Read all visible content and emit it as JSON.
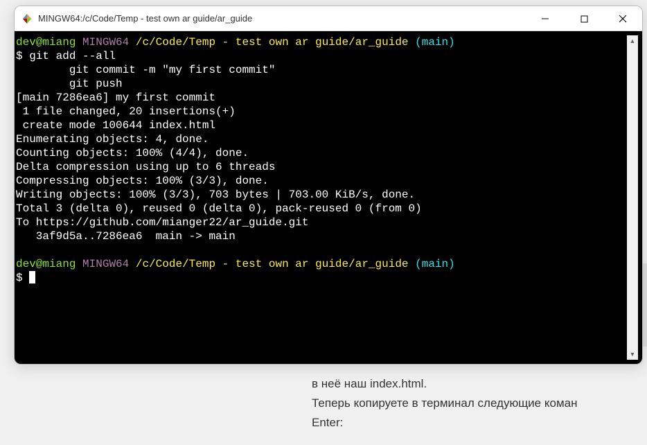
{
  "window": {
    "title": "MINGW64:/c/Code/Temp - test own ar guide/ar_guide"
  },
  "prompt": {
    "user_host": "dev@miang",
    "env": "MINGW64",
    "path": "/c/Code/Temp - test own ar guide/ar_guide",
    "branch_open": "(",
    "branch": "main",
    "branch_close": ")",
    "dollar": "$ "
  },
  "commands": {
    "cmd1": "git add --all",
    "cmd2": "        git commit -m \"my first commit\"",
    "cmd3": "        git push"
  },
  "output": {
    "l1": "[main 7286ea6] my first commit",
    "l2": " 1 file changed, 20 insertions(+)",
    "l3": " create mode 100644 index.html",
    "l4": "Enumerating objects: 4, done.",
    "l5": "Counting objects: 100% (4/4), done.",
    "l6": "Delta compression using up to 6 threads",
    "l7": "Compressing objects: 100% (3/3), done.",
    "l8": "Writing objects: 100% (3/3), 703 bytes | 703.00 KiB/s, done.",
    "l9": "Total 3 (delta 0), reused 0 (delta 0), pack-reused 0 (from 0)",
    "l10": "To https://github.com/mianger22/ar_guide.git",
    "l11": "   3af9d5a..7286ea6  main -> main"
  },
  "background": {
    "line1": "в неё наш index.html.",
    "line2": "Теперь копируете в терминал следующие коман",
    "line3": "Enter:"
  }
}
